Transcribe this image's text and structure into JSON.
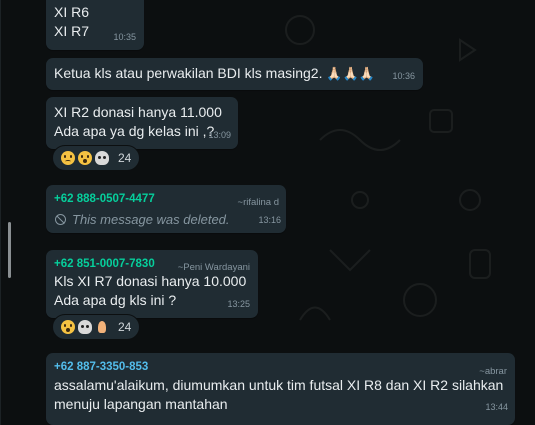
{
  "messages": [
    {
      "lines": [
        "XI R6",
        "XI R7"
      ],
      "time": "10:35"
    },
    {
      "text": "Ketua kls atau perwakilan BDI kls masing2.",
      "prayers": "🙏🏻🙏🏻🙏🏻",
      "time": "10:36"
    },
    {
      "lines": [
        "XI R2 donasi hanya 11.000",
        "Ada apa ya dg kelas ini ,?"
      ],
      "time": "13:09",
      "reaction_count": "24"
    },
    {
      "sender": "+62 888-0507-4477",
      "alias": "~rifalina d",
      "text": "This message was deleted.",
      "time": "13:16",
      "sender_color": "#06cf9c"
    },
    {
      "sender": "+62 851-0007-7830",
      "alias": "~Peni Wardayani",
      "lines": [
        "Kls XI R7 donasi hanya 10.000",
        "Ada apa dg kls ini ?"
      ],
      "time": "13:25",
      "reaction_count": "24",
      "sender_color": "#06cf9c"
    },
    {
      "sender": "+62 887-3350-853",
      "alias": "~abrar",
      "lines": [
        "assalamu'alaikum, diumumkan untuk tim futsal XI R8 dan XI R2 silahkan",
        "menuju lapangan mantahan"
      ],
      "time": "13:44",
      "sender_color": "#53bdeb"
    }
  ]
}
